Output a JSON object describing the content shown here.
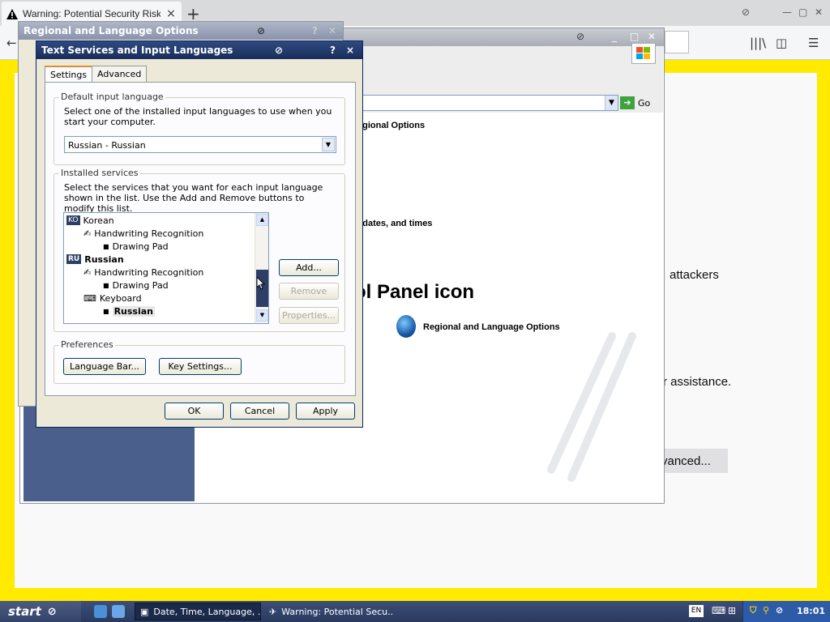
{
  "browser": {
    "tab_title": "Warning: Potential Security Risk A",
    "tab_close": "×",
    "new_tab": "+"
  },
  "page": {
    "text_attackers": "attackers",
    "text_assistance": "r assistance.",
    "advanced_button": "vanced..."
  },
  "control_panel": {
    "go_label": "Go",
    "heading_fragment": "ol Panel icon",
    "task_regional_fragment": "egional Options",
    "task_dates_fragment": "s, dates, and times",
    "icon_label": "Regional and Language Options"
  },
  "regional_dialog": {
    "title": "Regional and Language Options"
  },
  "dialog": {
    "title": "Text Services and Input Languages",
    "help": "?",
    "close": "×",
    "tabs": [
      "Settings",
      "Advanced"
    ],
    "default_group": {
      "label": "Default input language",
      "description": "Select one of the installed input languages to use when you start your computer.",
      "selected": "Russian - Russian"
    },
    "services_group": {
      "label": "Installed services",
      "description": "Select the services that you want for each input language shown in the list. Use the Add and Remove buttons to modify this list.",
      "tree": [
        {
          "tag": "KO",
          "label": "Korean"
        },
        {
          "label": "Handwriting Recognition"
        },
        {
          "label": "Drawing Pad"
        },
        {
          "tag": "RU",
          "label": "Russian"
        },
        {
          "label": "Handwriting Recognition"
        },
        {
          "label": "Drawing Pad"
        },
        {
          "label": "Keyboard"
        },
        {
          "label": "Russian"
        }
      ],
      "add": "Add...",
      "remove": "Remove",
      "properties": "Properties..."
    },
    "preferences_group": {
      "label": "Preferences",
      "language_bar": "Language Bar...",
      "key_settings": "Key Settings..."
    },
    "ok": "OK",
    "cancel": "Cancel",
    "apply": "Apply"
  },
  "taskbar": {
    "start": "start",
    "tasks": [
      "Date, Time, Language, ...",
      "Warning: Potential Secu..."
    ],
    "lang": "EN",
    "clock": "18:01"
  }
}
